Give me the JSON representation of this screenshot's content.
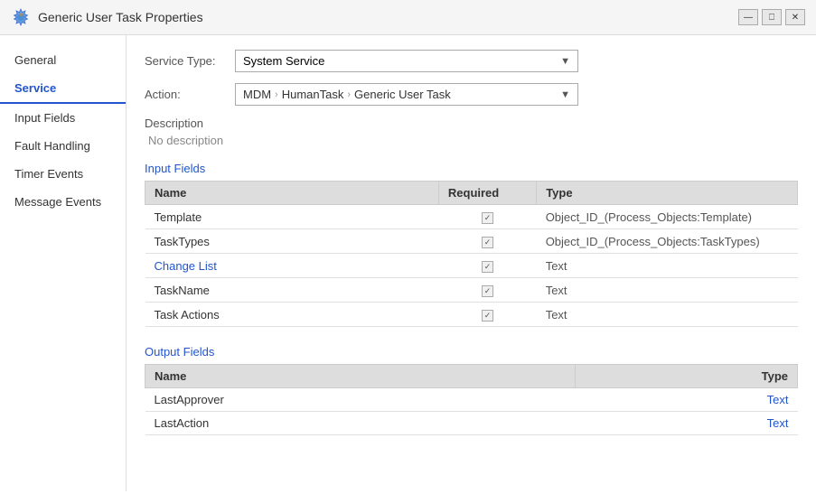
{
  "titleBar": {
    "title": "Generic User Task Properties",
    "controls": [
      "minimize",
      "restore",
      "close"
    ]
  },
  "sidebar": {
    "items": [
      {
        "id": "general",
        "label": "General",
        "active": false
      },
      {
        "id": "service",
        "label": "Service",
        "active": true
      },
      {
        "id": "input-fields",
        "label": "Input Fields",
        "active": false
      },
      {
        "id": "fault-handling",
        "label": "Fault Handling",
        "active": false
      },
      {
        "id": "timer-events",
        "label": "Timer Events",
        "active": false
      },
      {
        "id": "message-events",
        "label": "Message Events",
        "active": false
      }
    ]
  },
  "content": {
    "serviceTypeLabel": "Service Type:",
    "serviceTypeValue": "System Service",
    "actionLabel": "Action:",
    "actionBreadcrumb": [
      "MDM",
      "HumanTask",
      "Generic User Task"
    ],
    "descriptionHeading": "Description",
    "descriptionValue": "No description",
    "inputFieldsHeading": "Input Fields",
    "inputFieldsTable": {
      "columns": [
        "Name",
        "Required",
        "Type"
      ],
      "rows": [
        {
          "name": "Template",
          "required": true,
          "type": "Object_ID_(Process_Objects:Template)",
          "nameStyle": "black"
        },
        {
          "name": "TaskTypes",
          "required": true,
          "type": "Object_ID_(Process_Objects:TaskTypes)",
          "nameStyle": "black"
        },
        {
          "name": "Change List",
          "required": true,
          "type": "Text",
          "nameStyle": "blue"
        },
        {
          "name": "TaskName",
          "required": true,
          "type": "Text",
          "nameStyle": "black"
        },
        {
          "name": "Task Actions",
          "required": true,
          "type": "Text",
          "nameStyle": "black"
        }
      ]
    },
    "outputFieldsHeading": "Output Fields",
    "outputFieldsTable": {
      "columns": [
        "Name",
        "Type"
      ],
      "rows": [
        {
          "name": "LastApprover",
          "type": "Text"
        },
        {
          "name": "LastAction",
          "type": "Text"
        }
      ]
    }
  }
}
